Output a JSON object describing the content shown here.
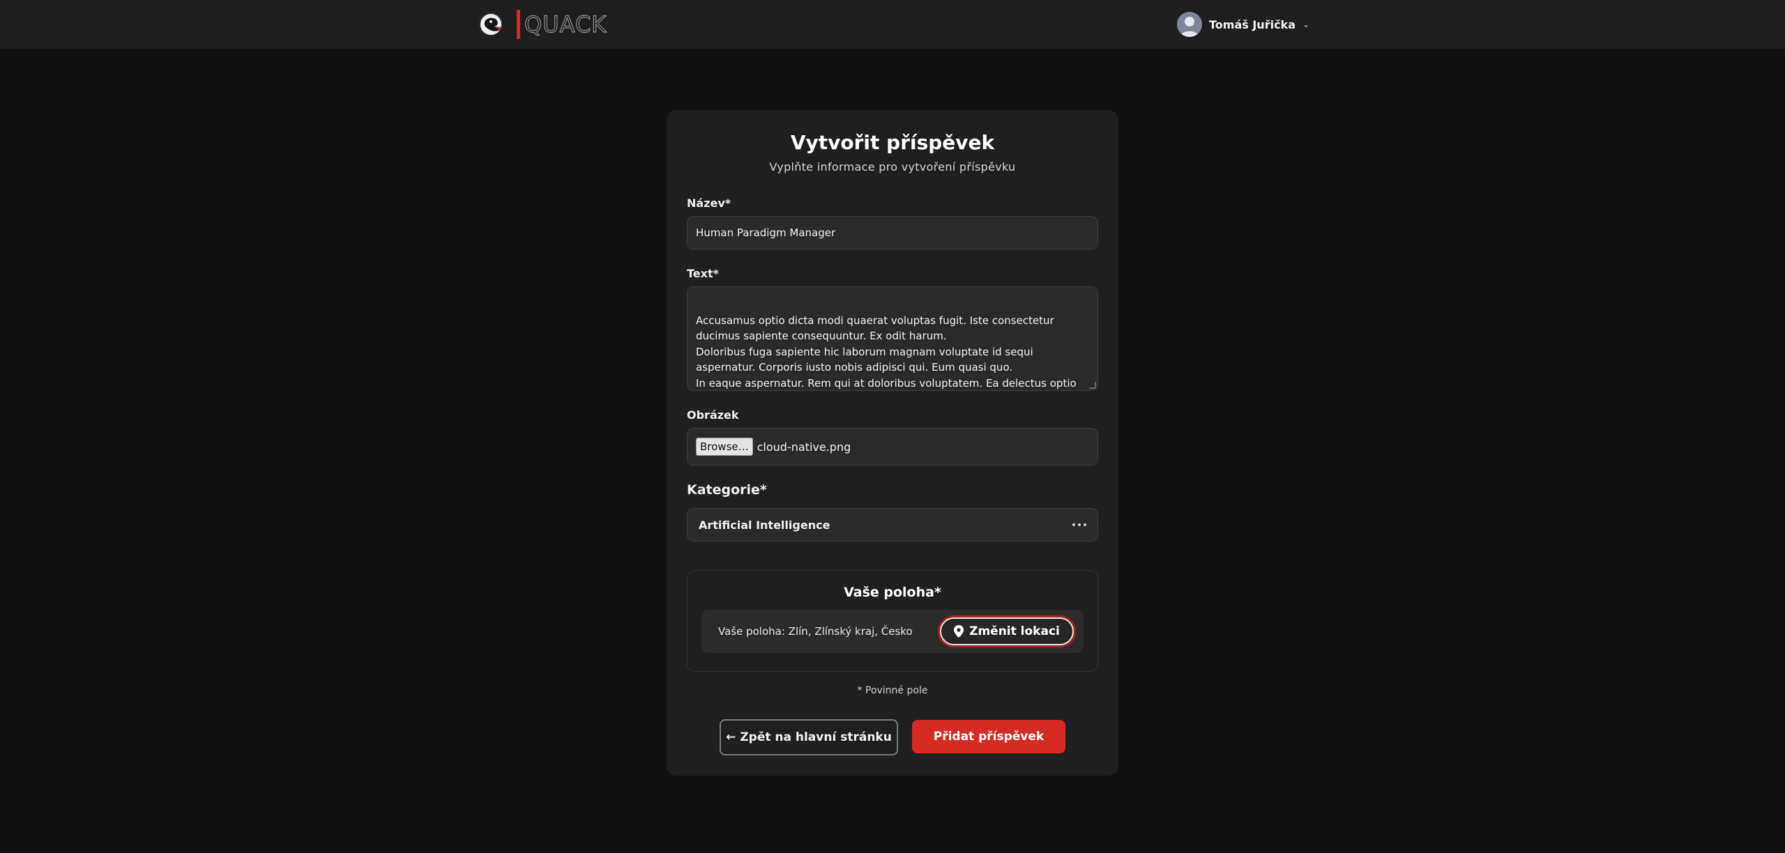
{
  "header": {
    "logo_text": "QUACK",
    "user_name": "Tomáš Juřička",
    "caret": "⌄"
  },
  "form": {
    "title": "Vytvořit příspěvek",
    "subtitle": "Vyplňte informace pro vytvoření příspěvku",
    "name_label": "Název*",
    "name_value": "Human Paradigm Manager",
    "text_label": "Text*",
    "text_value": "Accusamus optio dicta modi quaerat voluptas fugit. Iste consectetur ducimus sapiente consequuntur. Ex odit harum.\nDoloribus fuga sapiente hic laborum magnam voluptate id sequi aspernatur. Corporis iusto nobis adipisci qui. Eum quasi quo.\nIn eaque aspernatur. Rem qui at doloribus voluptatem. Ea delectus optio quod doloremque quia dolor tempora minima.",
    "image_label": "Obrázek",
    "browse_label": "Browse…",
    "file_name": "cloud-native.png",
    "category_label": "Kategorie*",
    "category_value": "Artificial Intelligence",
    "location_title": "Vaše poloha*",
    "location_text": "Vaše poloha: Zlín, Zlínský kraj, Česko",
    "change_location_label": "Změnit lokaci",
    "required_note": "* Povinné pole",
    "back_label": "← Zpět na hlavní stránku",
    "submit_label": "Přidat příspěvek"
  },
  "colors": {
    "accent": "#d62b22",
    "background": "#111111",
    "card": "#1f1f1f"
  }
}
